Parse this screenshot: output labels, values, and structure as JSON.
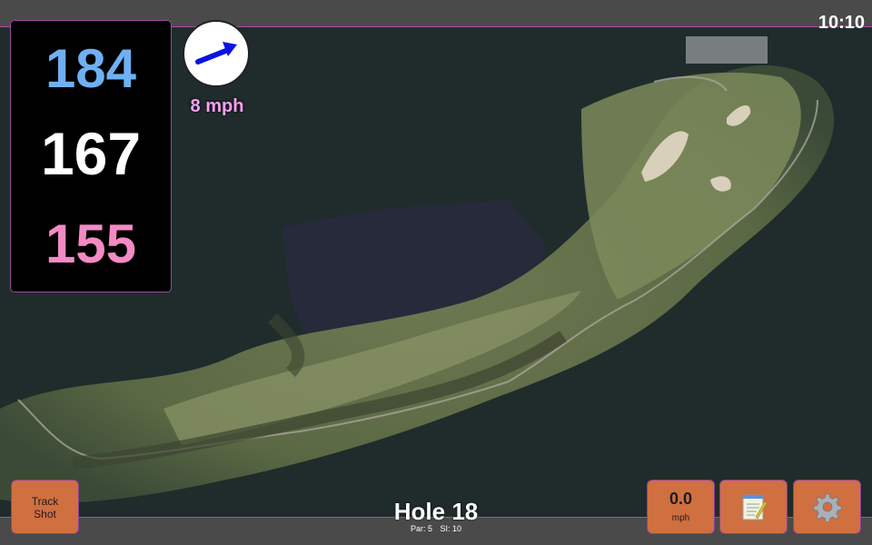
{
  "status": {
    "clock": "10:10"
  },
  "distances": {
    "back": "184",
    "middle": "167",
    "front": "155"
  },
  "colors": {
    "back": "#6fb0f5",
    "middle": "#ffffff",
    "front": "#f38ac4",
    "button": "#d06f40",
    "accent_border": "#b04aa8",
    "wind_arrow": "#0a14e0"
  },
  "wind": {
    "speed_label": "8 mph",
    "icon": "wind-direction-arrow-icon"
  },
  "hole": {
    "title": "Hole 18",
    "par": "Par: 5",
    "stroke_index": "SI: 10"
  },
  "buttons": {
    "track_shot": "Track\nShot",
    "speed_value": "0.0",
    "speed_unit": "mph",
    "notes_icon": "notepad-icon",
    "settings_icon": "gear-icon"
  }
}
